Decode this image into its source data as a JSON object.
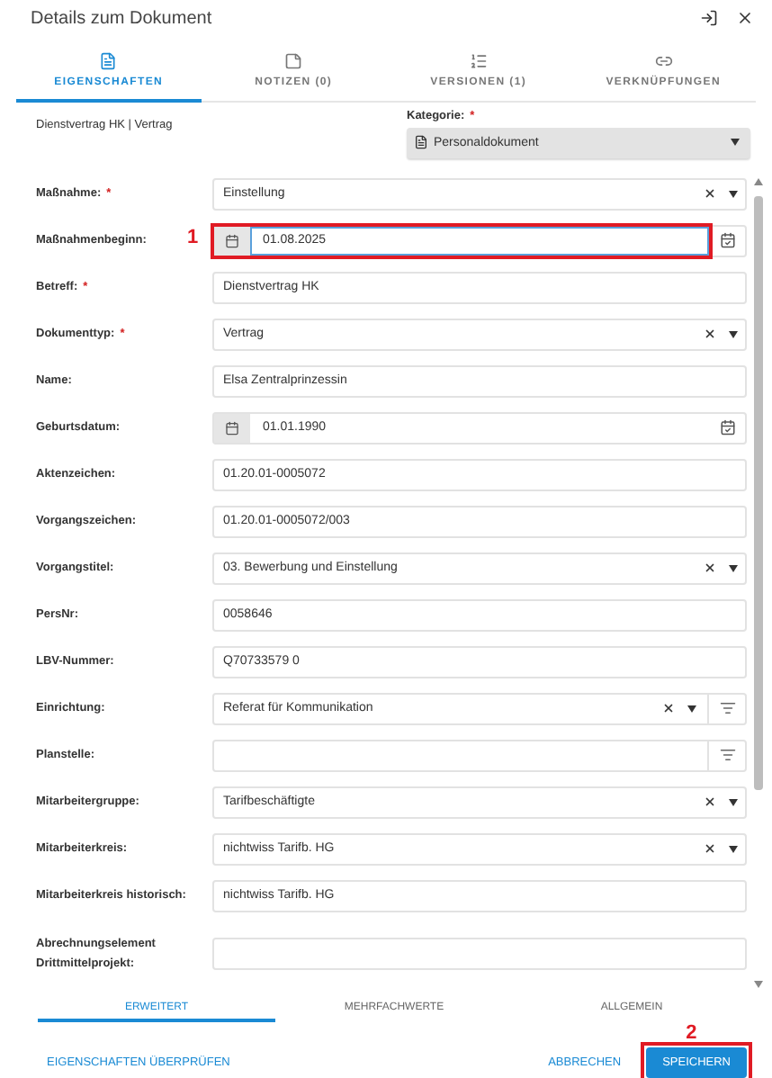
{
  "title": "Details zum Dokument",
  "tabs": [
    {
      "label": "EIGENSCHAFTEN",
      "selected": true
    },
    {
      "label": "NOTIZEN (0)",
      "selected": false
    },
    {
      "label": "VERSIONEN (1)",
      "selected": false
    },
    {
      "label": "VERKNÜPFUNGEN",
      "selected": false
    }
  ],
  "summary": "Dienstvertrag HK | Vertrag",
  "category": {
    "label": "Kategorie:",
    "required_mark": "*",
    "value": "Personaldokument"
  },
  "fields": [
    {
      "label": "Maßnahme:",
      "required_mark": "*",
      "kind": "select",
      "value": "Einstellung"
    },
    {
      "label": "Maßnahmenbeginn:",
      "kind": "date",
      "value": "01.08.2025",
      "focused": true,
      "annotation": "1"
    },
    {
      "label": "Betreff:",
      "required_mark": "*",
      "kind": "text",
      "value": "Dienstvertrag HK"
    },
    {
      "label": "Dokumenttyp:",
      "required_mark": "*",
      "kind": "select",
      "value": "Vertrag"
    },
    {
      "label": "Name:",
      "kind": "text",
      "value": "Elsa Zentralprinzessin"
    },
    {
      "label": "Geburtsdatum:",
      "kind": "date",
      "value": "01.01.1990",
      "focused": false
    },
    {
      "label": "Aktenzeichen:",
      "kind": "text",
      "value": "01.20.01-0005072"
    },
    {
      "label": "Vorgangszeichen:",
      "kind": "text",
      "value": "01.20.01-0005072/003"
    },
    {
      "label": "Vorgangstitel:",
      "kind": "select",
      "value": "03. Bewerbung und Einstellung"
    },
    {
      "label": "PersNr:",
      "kind": "text",
      "value": "0058646"
    },
    {
      "label": "LBV-Nummer:",
      "kind": "text",
      "value": "Q70733579 0"
    },
    {
      "label": "Einrichtung:",
      "kind": "select-picker",
      "value": "Referat für Kommunikation"
    },
    {
      "label": "Planstelle:",
      "kind": "picker"
    },
    {
      "label": "Mitarbeitergruppe:",
      "kind": "select",
      "value": "Tarifbeschäftigte"
    },
    {
      "label": "Mitarbeiterkreis:",
      "kind": "select",
      "value": "nichtwiss Tarifb. HG"
    },
    {
      "label": "Mitarbeiterkreis historisch:",
      "kind": "text",
      "value": "nichtwiss Tarifb. HG"
    },
    {
      "label": "Abrechnungselement Drittmittelprojekt:",
      "kind": "text"
    }
  ],
  "bottom_tabs": [
    {
      "label": "ERWEITERT",
      "selected": true
    },
    {
      "label": "MEHRFACHWERTE",
      "selected": false
    },
    {
      "label": "ALLGEMEIN",
      "selected": false
    }
  ],
  "actions": {
    "check": "EIGENSCHAFTEN ÜBERPRÜFEN",
    "cancel": "ABBRECHEN",
    "save": "SPEICHERN",
    "save_annotation": "2"
  }
}
